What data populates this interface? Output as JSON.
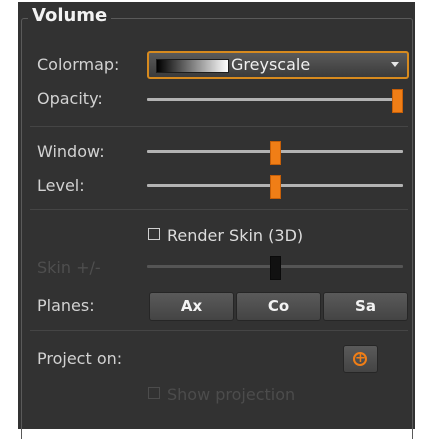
{
  "group": {
    "title": "Volume"
  },
  "colormap": {
    "label": "Colormap:",
    "value": "Greyscale"
  },
  "opacity": {
    "label": "Opacity:",
    "level_fraction": 1.0
  },
  "window": {
    "label": "Window:",
    "level_fraction": 0.5
  },
  "level": {
    "label": "Level:",
    "level_fraction": 0.5
  },
  "render_skin": {
    "label": "Render Skin (3D)",
    "checked": false
  },
  "skin": {
    "label": "Skin +/-",
    "level_fraction": 0.5,
    "enabled": false
  },
  "planes": {
    "label": "Planes:",
    "buttons": [
      "Ax",
      "Co",
      "Sa"
    ]
  },
  "project": {
    "label": "Project on:",
    "icon": "plus-circle-icon"
  },
  "show_projection": {
    "label": "Show projection",
    "checked": false,
    "enabled": false
  },
  "colors": {
    "panel_background": "#323232",
    "accent": "#f07e16",
    "text": "#d2d2d2",
    "disabled_text": "#4e4e4e"
  }
}
